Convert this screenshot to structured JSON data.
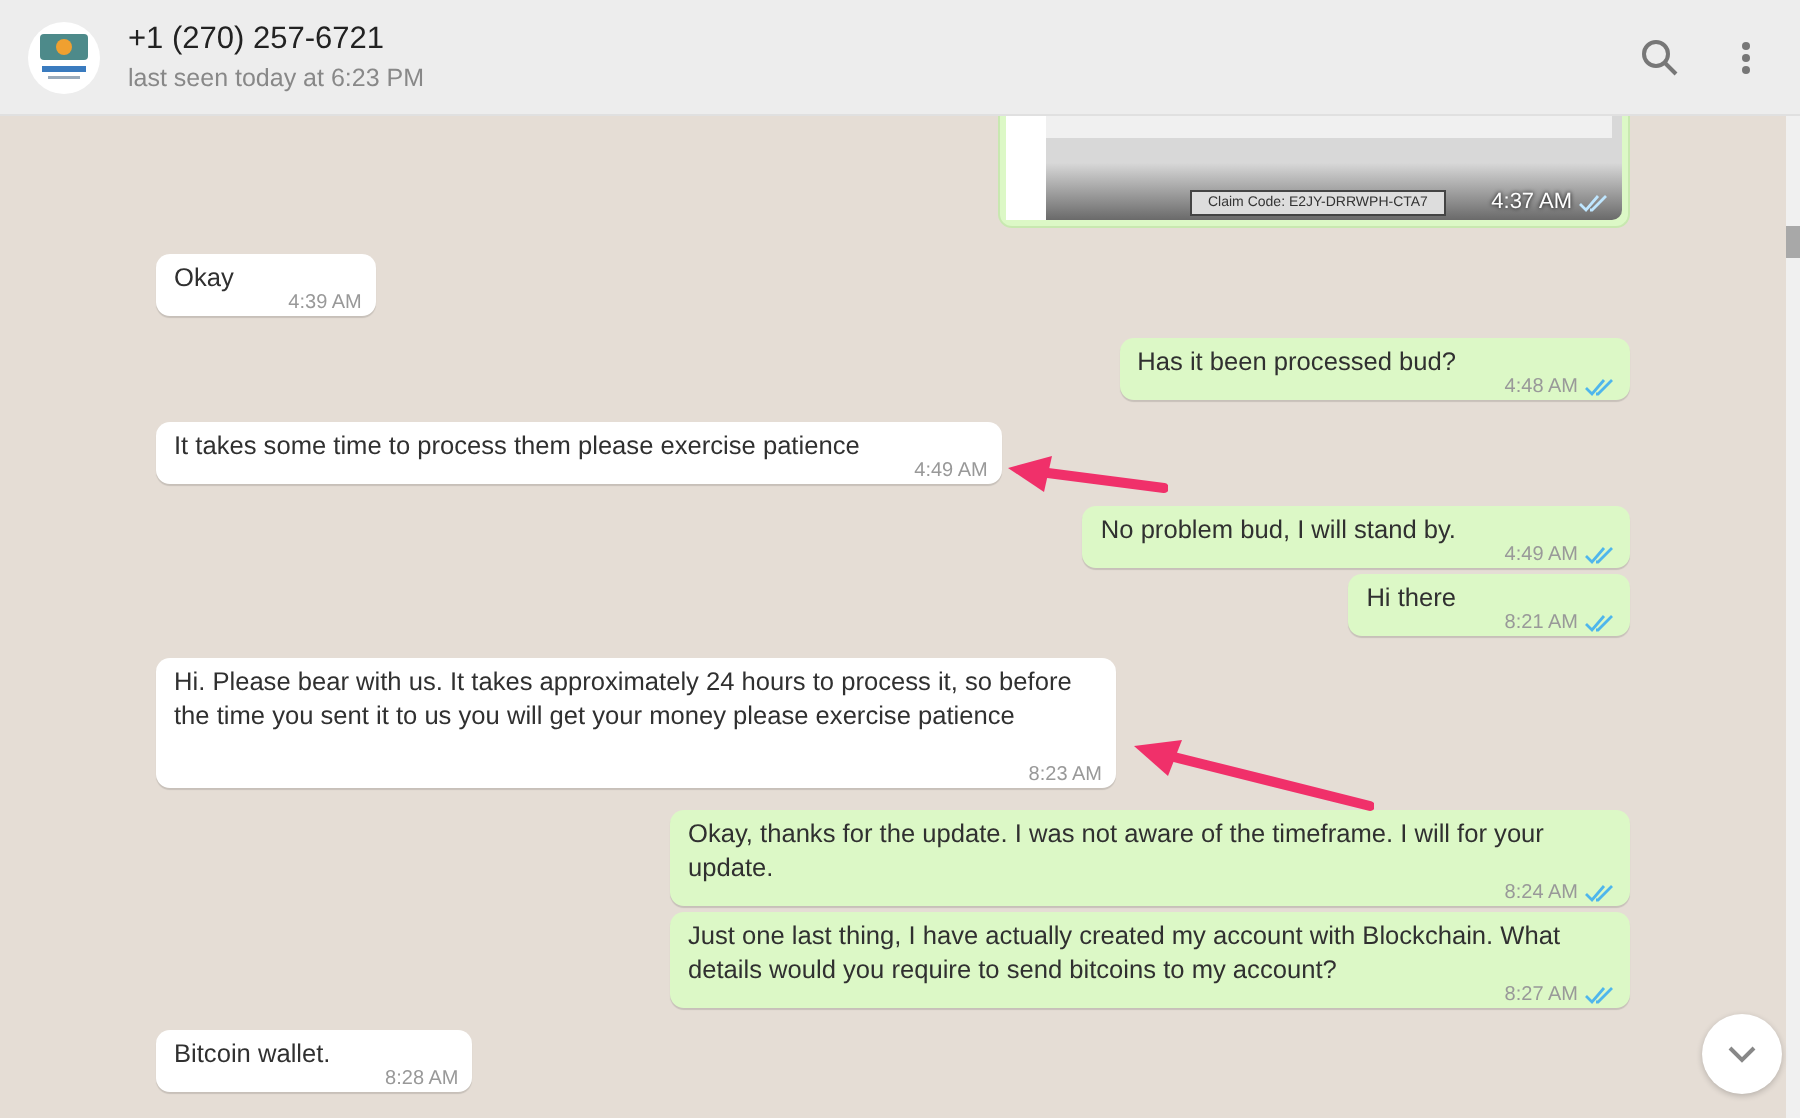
{
  "header": {
    "contact_name": "+1 (270) 257-6721",
    "status": "last seen today at 6:23 PM"
  },
  "image_message": {
    "claim_code": "Claim Code: E2JY-DRRWPH-CTA7",
    "time": "4:37 AM",
    "read": true
  },
  "messages": [
    {
      "kind": "incoming",
      "text": "Okay",
      "time": "4:39 AM"
    },
    {
      "kind": "outgoing",
      "text": "Has it  been processed bud?",
      "time": "4:48 AM",
      "read": true
    },
    {
      "kind": "incoming",
      "text": "It takes some time to process them please exercise patience",
      "time": "4:49 AM"
    },
    {
      "kind": "outgoing",
      "text": "No problem bud, I will stand by.",
      "time": "4:49 AM",
      "read": true
    },
    {
      "kind": "outgoing",
      "text": "Hi there",
      "time": "8:21 AM",
      "read": true
    },
    {
      "kind": "incoming",
      "text": "Hi. Please bear with us. It takes approximately 24 hours to process it, so before the time you sent it to us you will get your money please exercise patience",
      "time": "8:23 AM"
    },
    {
      "kind": "outgoing",
      "text": "Okay, thanks for the update. I was not aware of the timeframe. I will for your update.",
      "time": "8:24 AM",
      "read": true
    },
    {
      "kind": "outgoing",
      "text": "Just one last thing, I have actually created my account with Blockchain. What details would you require to send bitcoins to my account?",
      "time": "8:27 AM",
      "read": true
    },
    {
      "kind": "incoming",
      "text": "Bitcoin wallet.",
      "time": "8:28 AM"
    }
  ]
}
